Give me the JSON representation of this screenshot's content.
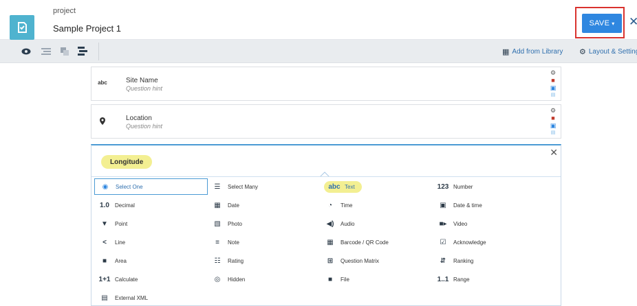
{
  "header": {
    "project_caption": "project",
    "project_name": "Sample Project 1",
    "save_label": "SAVE",
    "save_caret": "▾",
    "close_glyph": "✕",
    "brand_color": "#4fb3cf",
    "save_color": "#2f87e0"
  },
  "toolbar": {
    "add_from_library": "Add from Library",
    "layout_settings": "Layout & Settings"
  },
  "questions": [
    {
      "type_icon": "abc",
      "label": "Site Name",
      "hint": "Question hint"
    },
    {
      "type_icon": "●",
      "label": "Location",
      "hint": "Question hint"
    }
  ],
  "picker": {
    "field_name": "Longitude",
    "close_glyph": "✕",
    "types": [
      {
        "label": "Select One",
        "icon": "◉",
        "state": "selected"
      },
      {
        "label": "Select Many",
        "icon": "☰",
        "state": ""
      },
      {
        "label": "Text",
        "icon": "abc",
        "state": "highlighted"
      },
      {
        "label": "Number",
        "icon": "123",
        "state": ""
      },
      {
        "label": "Decimal",
        "icon": "1.0",
        "state": ""
      },
      {
        "label": "Date",
        "icon": "▦",
        "state": ""
      },
      {
        "label": "Time",
        "icon": "◔",
        "state": ""
      },
      {
        "label": "Date & time",
        "icon": "▣",
        "state": ""
      },
      {
        "label": "Point",
        "icon": "▼",
        "state": ""
      },
      {
        "label": "Photo",
        "icon": "▧",
        "state": ""
      },
      {
        "label": "Audio",
        "icon": "◀)",
        "state": ""
      },
      {
        "label": "Video",
        "icon": "■▸",
        "state": ""
      },
      {
        "label": "Line",
        "icon": "<",
        "state": ""
      },
      {
        "label": "Note",
        "icon": "≡",
        "state": ""
      },
      {
        "label": "Barcode / QR Code",
        "icon": "▦",
        "state": ""
      },
      {
        "label": "Acknowledge",
        "icon": "☑",
        "state": ""
      },
      {
        "label": "Area",
        "icon": "■",
        "state": ""
      },
      {
        "label": "Rating",
        "icon": "☷",
        "state": ""
      },
      {
        "label": "Question Matrix",
        "icon": "⊞",
        "state": ""
      },
      {
        "label": "Ranking",
        "icon": "⇵",
        "state": ""
      },
      {
        "label": "Calculate",
        "icon": "1+1",
        "state": ""
      },
      {
        "label": "Hidden",
        "icon": "◎",
        "state": ""
      },
      {
        "label": "File",
        "icon": "■",
        "state": ""
      },
      {
        "label": "Range",
        "icon": "1..1",
        "state": ""
      },
      {
        "label": "External XML",
        "icon": "▤",
        "state": ""
      }
    ]
  }
}
